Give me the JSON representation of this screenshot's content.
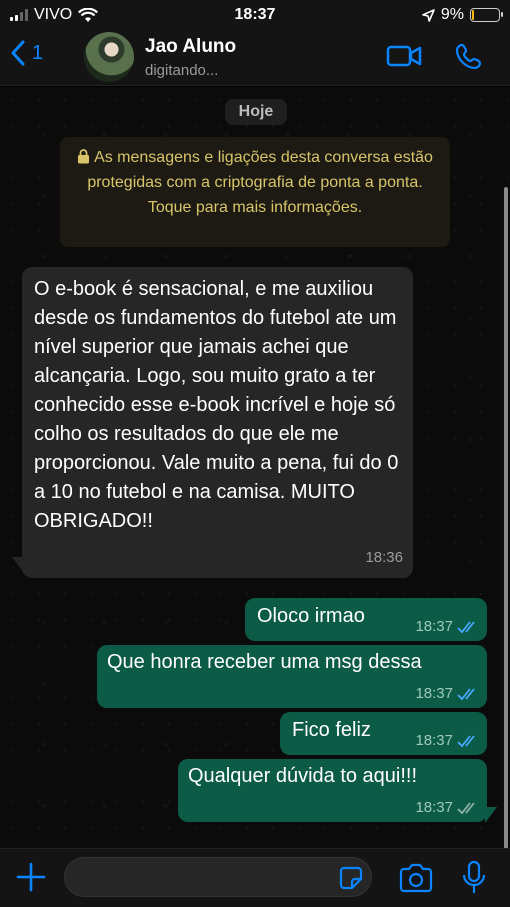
{
  "status_bar": {
    "carrier": "VIVO",
    "time": "18:37",
    "battery_percent": "9%",
    "battery_level": 0.09,
    "battery_color": "#f0b400"
  },
  "header": {
    "back_badge": "1",
    "contact_name": "Jao Aluno",
    "contact_status": "digitando...",
    "icons": [
      "back-chevron-icon",
      "video-call-icon",
      "phone-call-icon"
    ],
    "accent_color": "#0a84ff"
  },
  "chat": {
    "date_label": "Hoje",
    "encryption_notice": "As mensagens e ligações desta conversa estão protegidas com a criptografia de ponta a ponta. Toque para mais informações.",
    "messages": [
      {
        "direction": "incoming",
        "text": "O e-book é sensacional, e me auxiliou desde os fundamentos do futebol ate um nível superior que jamais achei que alcançaria. Logo, sou muito grato a ter conhecido esse e-book incrível e hoje só colho os resultados do que ele me proporcionou. Vale muito a pena, fui do 0 a 10 no futebol e na camisa. MUITO OBRIGADO!!",
        "time": "18:36"
      },
      {
        "direction": "outgoing",
        "text": "Oloco irmao",
        "time": "18:37",
        "status": "read"
      },
      {
        "direction": "outgoing",
        "text": "Que honra receber uma msg dessa",
        "time": "18:37",
        "status": "read"
      },
      {
        "direction": "outgoing",
        "text": "Fico feliz",
        "time": "18:37",
        "status": "read"
      },
      {
        "direction": "outgoing",
        "text": "Qualquer dúvida to aqui!!!",
        "time": "18:37",
        "status": "delivered"
      }
    ],
    "outgoing_bubble_color": "#0b5b46",
    "incoming_bubble_color": "#262626"
  },
  "input_bar": {
    "message_value": "",
    "icons": [
      "plus-icon",
      "sticker-icon",
      "camera-icon",
      "microphone-icon"
    ]
  }
}
